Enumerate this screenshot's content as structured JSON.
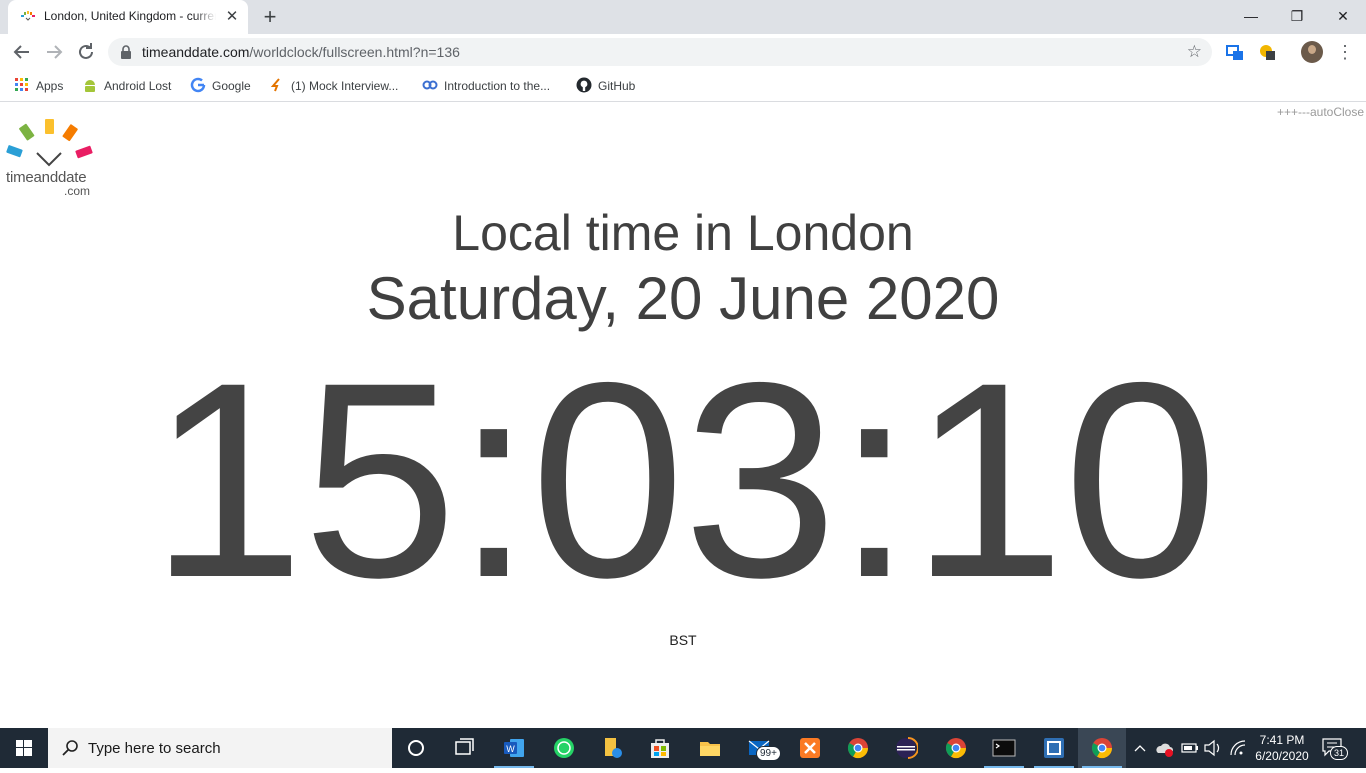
{
  "browser": {
    "tab": {
      "title": "London, United Kingdom - current local time",
      "close_glyph": "✕"
    },
    "new_tab_glyph": "+",
    "window_controls": {
      "minimize": "—",
      "maximize": "❐",
      "close": "✕"
    },
    "url": {
      "host": "timeanddate.com",
      "path": "/worldclock/fullscreen.html?n=136"
    },
    "bookmarks": [
      {
        "label": "Apps",
        "icon": "apps-grid-icon"
      },
      {
        "label": "Android Lost",
        "icon": "android-icon"
      },
      {
        "label": "Google",
        "icon": "google-icon"
      },
      {
        "label": "(1) Mock Interview...",
        "icon": "interview-icon"
      },
      {
        "label": "Introduction to the...",
        "icon": "link-loop-icon"
      },
      {
        "label": "GitHub",
        "icon": "github-icon"
      }
    ]
  },
  "page": {
    "autoclose": "+++---autoClose",
    "logo": {
      "name": "timeanddate",
      "suffix": ".com"
    },
    "heading": "Local time in London",
    "date": "Saturday, 20 June 2020",
    "time": "15:03:10",
    "timezone": "BST"
  },
  "taskbar": {
    "search_placeholder": "Type here to search",
    "mail_badge": "99+",
    "clock_time": "7:41 PM",
    "clock_date": "6/20/2020",
    "notification_count": "31"
  },
  "colors": {
    "tab_strip": "#dee1e6",
    "clock_text": "#444444",
    "taskbar": "#1f2a36"
  }
}
